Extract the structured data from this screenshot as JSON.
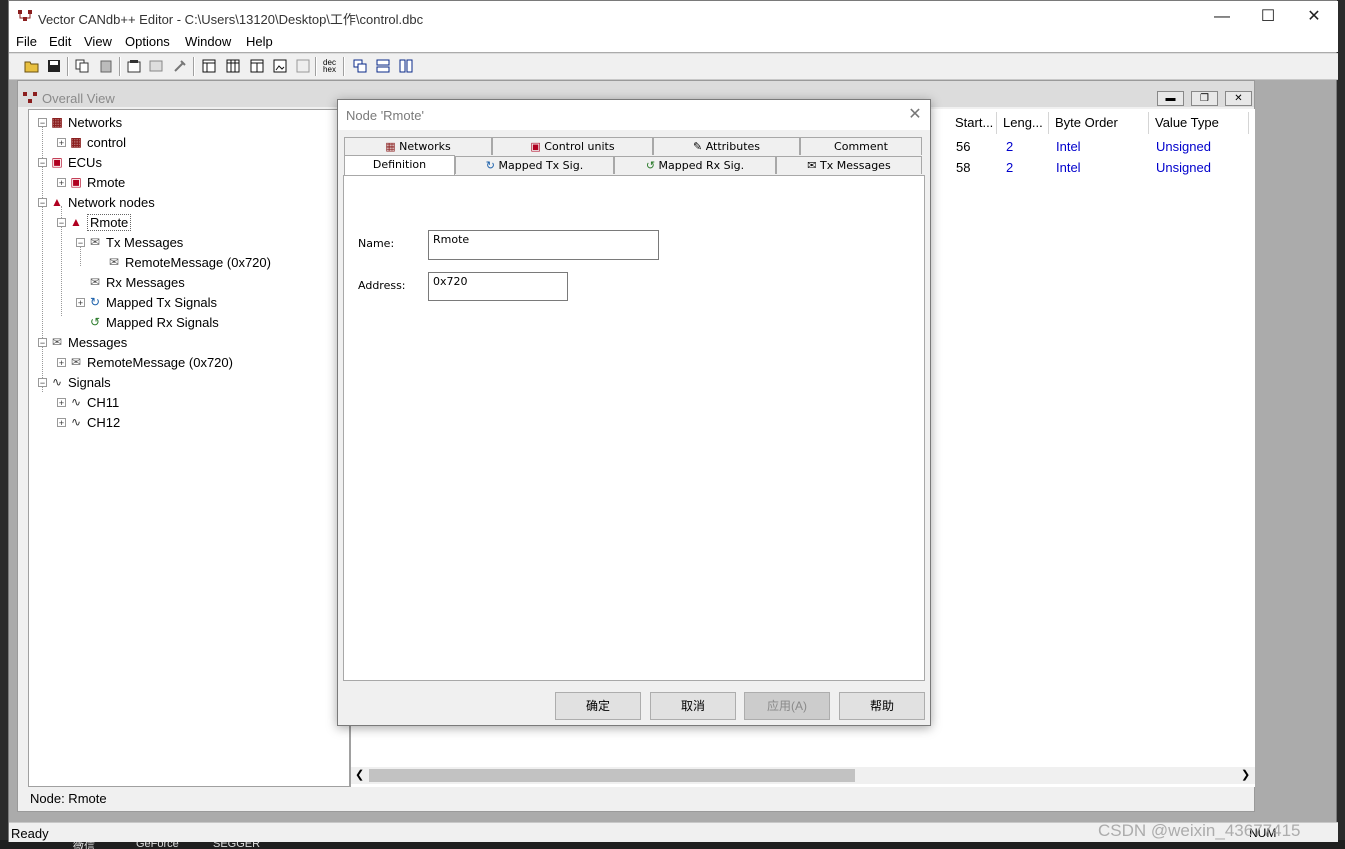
{
  "app": {
    "title": "Vector CANdb++ Editor - C:\\Users\\13120\\Desktop\\工作\\control.dbc",
    "menu": [
      "File",
      "Edit",
      "View",
      "Options",
      "Window",
      "Help"
    ],
    "toolbar_dec_hex": "dec hex",
    "status_left": "Ready",
    "status_right": "NUM"
  },
  "overall_view": {
    "title": "Overall View",
    "tree": {
      "networks": "Networks",
      "network_control": "control",
      "ecus": "ECUs",
      "ecu_rmote": "Rmote",
      "network_nodes": "Network nodes",
      "node_rmote": "Rmote",
      "tx_messages": "Tx Messages",
      "tx_remote_message": "RemoteMessage (0x720)",
      "rx_messages": "Rx Messages",
      "mapped_tx": "Mapped Tx Signals",
      "mapped_rx": "Mapped Rx Signals",
      "messages": "Messages",
      "msg_remote_message": "RemoteMessage (0x720)",
      "signals": "Signals",
      "sig_ch11": "CH11",
      "sig_ch12": "CH12"
    },
    "status": "Node: Rmote",
    "table": {
      "headers": [
        "Start...",
        "Leng...",
        "Byte Order",
        "Value Type"
      ],
      "rows": [
        [
          "56",
          "2",
          "Intel",
          "Unsigned"
        ],
        [
          "58",
          "2",
          "Intel",
          "Unsigned"
        ]
      ]
    }
  },
  "dialog": {
    "title": "Node 'Rmote'",
    "tabs_row1": [
      "Networks",
      "Control units",
      "Attributes",
      "Comment"
    ],
    "tabs_row2": [
      "Definition",
      "Mapped Tx Sig.",
      "Mapped Rx Sig.",
      "Tx Messages"
    ],
    "name_label": "Name:",
    "name_value": "Rmote",
    "address_label": "Address:",
    "address_value": "0x720",
    "buttons": [
      "确定",
      "取消",
      "应用(A)",
      "帮助"
    ]
  },
  "desktop": {
    "taskbar_items": [
      "微信",
      "GeForce",
      "SEGGER"
    ],
    "watermark": "CSDN @weixin_43677415"
  }
}
